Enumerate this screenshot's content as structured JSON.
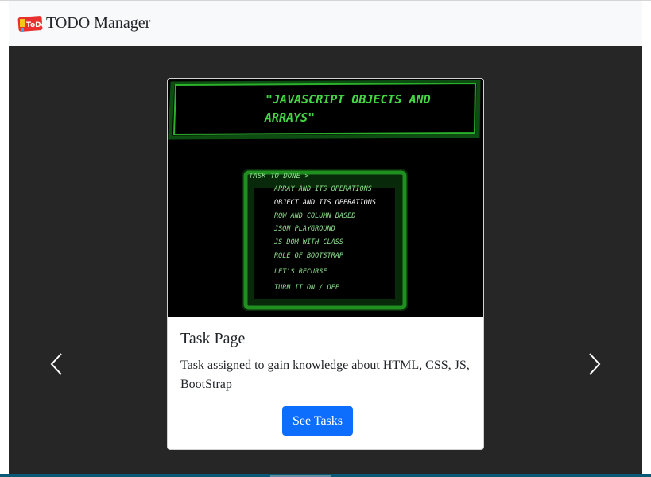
{
  "navbar": {
    "brand_text": "TODO Manager",
    "logo_text": "ToDo"
  },
  "card": {
    "title": "Task Page",
    "text": "Task assigned to gain knowledge about HTML, CSS, JS, BootStrap",
    "button_label": "See Tasks",
    "image": {
      "heading_line1": "\"JAVASCRIPT OBJECTS AND",
      "heading_line2": "ARRAYS\"",
      "menu_title": "TASK TO DONE >",
      "menu_items": [
        "ARRAY AND ITS OPERATIONS",
        "OBJECT AND ITS OPERATIONS",
        "ROW AND COLUMN BASED",
        "JSON PLAYGROUND",
        "JS DOM WITH CLASS",
        "ROLE OF BOOTSTRAP",
        "LET'S RECURSE",
        "TURN IT ON / OFF"
      ]
    }
  },
  "colors": {
    "primary": "#0d6efd",
    "navbar_bg": "#f8f9fa",
    "carousel_bg": "#262626",
    "retro_green": "#2ecc2e"
  },
  "icons": {
    "prev": "chevron-left-icon",
    "next": "chevron-right-icon"
  }
}
